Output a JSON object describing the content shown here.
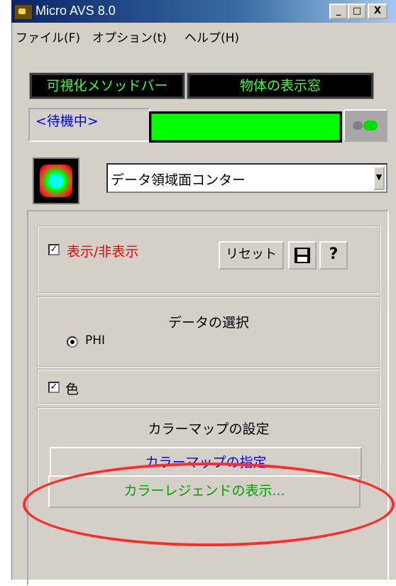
{
  "window": {
    "title": "Micro AVS 8.0",
    "minimize": "_",
    "maximize": "□",
    "close": "X"
  },
  "menu": [
    "ファイル(F)",
    "オプション(t)",
    "ヘルプ(H)"
  ],
  "toolbar": {
    "viz_method_bar": "可視化メソッドバー",
    "object_display": "物体の表示窓"
  },
  "status": {
    "text": "<待機中>",
    "progress_fraction": 1.0
  },
  "module": {
    "selected": "データ領域面コンター"
  },
  "display_section": {
    "checkbox_label": "表示/非表示",
    "checked": true,
    "reset_label": "リセット",
    "help_label": "?"
  },
  "data_section": {
    "title": "データの選択",
    "option": "PHI"
  },
  "color_section": {
    "checkbox_label": "色",
    "checked": true
  },
  "colormap_section": {
    "title": "カラーマップの設定",
    "specify_button": "カラーマップの指定",
    "legend_button": "カラーレジェンドの表示..."
  },
  "colors": {
    "accent_green": "#00ff00",
    "label_red": "#ff0000",
    "link_blue": "#0000ff",
    "legend_green": "#00a000",
    "highlight": "#ff2a2a"
  }
}
